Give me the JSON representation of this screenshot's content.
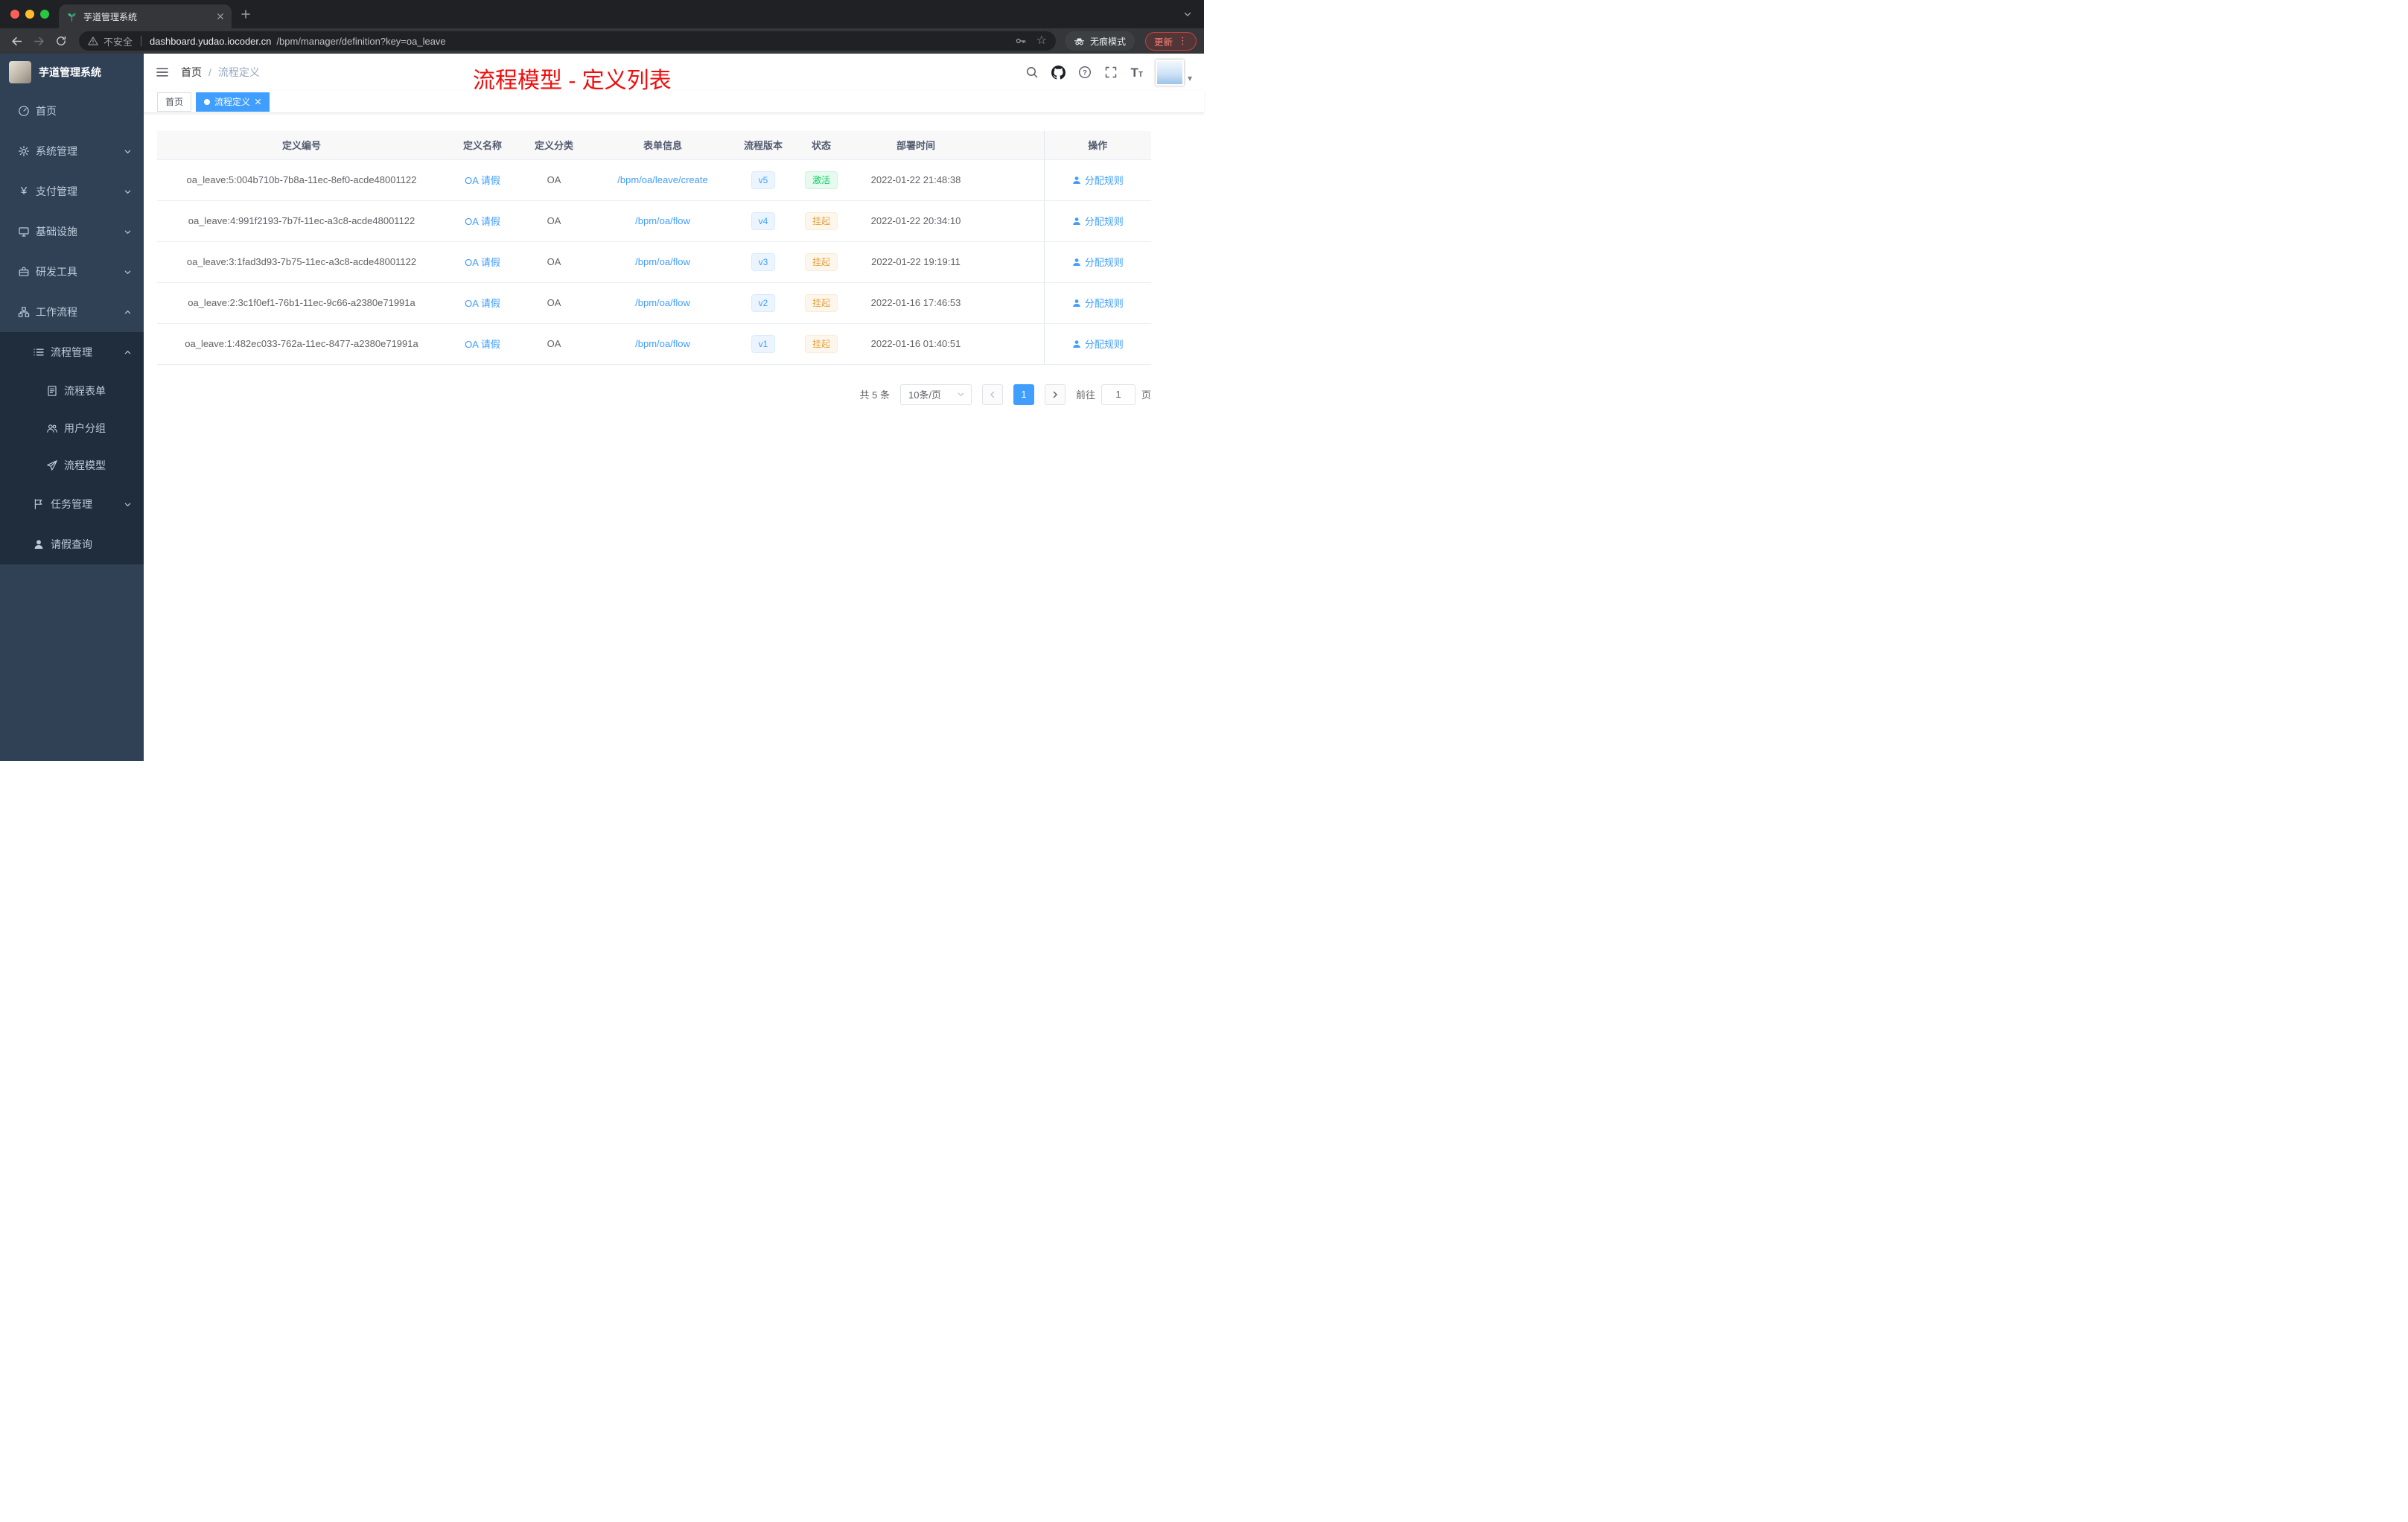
{
  "browser": {
    "tab_title": "芋道管理系统",
    "security": "不安全",
    "url_domain": "dashboard.yudao.iocoder.cn",
    "url_path": "/bpm/manager/definition?key=oa_leave",
    "incognito": "无痕模式",
    "update": "更新"
  },
  "sidebar": {
    "logo_title": "芋道管理系统",
    "items": [
      {
        "label": "首页"
      },
      {
        "label": "系统管理"
      },
      {
        "label": "支付管理"
      },
      {
        "label": "基础设施"
      },
      {
        "label": "研发工具"
      },
      {
        "label": "工作流程"
      },
      {
        "label": "流程管理"
      },
      {
        "label": "流程表单"
      },
      {
        "label": "用户分组"
      },
      {
        "label": "流程模型"
      },
      {
        "label": "任务管理"
      },
      {
        "label": "请假查询"
      }
    ]
  },
  "navbar": {
    "breadcrumb_home": "首页",
    "breadcrumb_sep": "/",
    "breadcrumb_current": "流程定义",
    "annotation": "流程模型 - 定义列表"
  },
  "tags": {
    "home": "首页",
    "active": "流程定义"
  },
  "table": {
    "headers": [
      "定义编号",
      "定义名称",
      "定义分类",
      "表单信息",
      "流程版本",
      "状态",
      "部署时间",
      "操作"
    ],
    "rows": [
      {
        "id": "oa_leave:5:004b710b-7b8a-11ec-8ef0-acde48001122",
        "name": "OA 请假",
        "category": "OA",
        "form": "/bpm/oa/leave/create",
        "version": "v5",
        "status": "激活",
        "time": "2022-01-22 21:48:38",
        "action": "分配规则"
      },
      {
        "id": "oa_leave:4:991f2193-7b7f-11ec-a3c8-acde48001122",
        "name": "OA 请假",
        "category": "OA",
        "form": "/bpm/oa/flow",
        "version": "v4",
        "status": "挂起",
        "time": "2022-01-22 20:34:10",
        "action": "分配规则"
      },
      {
        "id": "oa_leave:3:1fad3d93-7b75-11ec-a3c8-acde48001122",
        "name": "OA 请假",
        "category": "OA",
        "form": "/bpm/oa/flow",
        "version": "v3",
        "status": "挂起",
        "time": "2022-01-22 19:19:11",
        "action": "分配规则"
      },
      {
        "id": "oa_leave:2:3c1f0ef1-76b1-11ec-9c66-a2380e71991a",
        "name": "OA 请假",
        "category": "OA",
        "form": "/bpm/oa/flow",
        "version": "v2",
        "status": "挂起",
        "time": "2022-01-16 17:46:53",
        "action": "分配规则"
      },
      {
        "id": "oa_leave:1:482ec033-762a-11ec-8477-a2380e71991a",
        "name": "OA 请假",
        "category": "OA",
        "form": "/bpm/oa/flow",
        "version": "v1",
        "status": "挂起",
        "time": "2022-01-16 01:40:51",
        "action": "分配规则"
      }
    ]
  },
  "pagination": {
    "total": "共 5 条",
    "page_size": "10条/页",
    "current": "1",
    "goto_label": "前往",
    "goto_value": "1",
    "unit": "页"
  },
  "colors": {
    "accent_blue": "#409eff",
    "success_green": "#13ce66",
    "warning_orange": "#e6a23c",
    "annotation_red": "#f20d0d",
    "sidebar_bg": "#304156",
    "submenu_bg": "#1f2d3d"
  }
}
